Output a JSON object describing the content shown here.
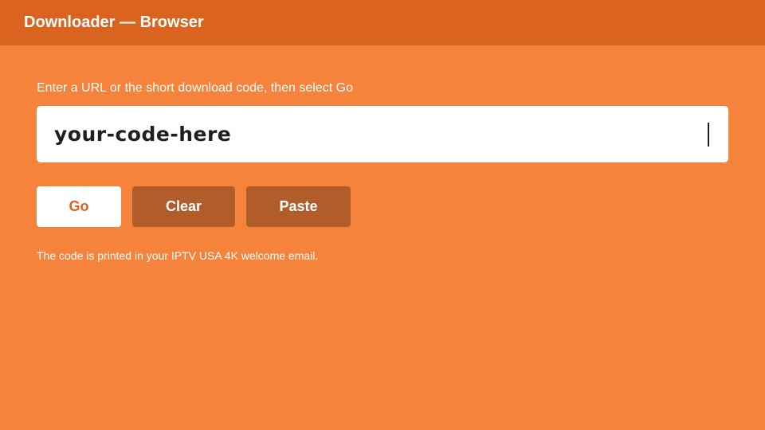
{
  "header": {
    "title": "Downloader — Browser"
  },
  "main": {
    "prompt": "Enter a URL or the short download code, then select Go",
    "url_input": {
      "value": "your-code-here"
    },
    "buttons": {
      "go": "Go",
      "clear": "Clear",
      "paste": "Paste"
    },
    "hint": "The code is printed in your IPTV USA 4K welcome email."
  },
  "colors": {
    "background": "#f5833c",
    "header": "#db6320",
    "secondary_button": "#b05c2b",
    "primary_button_text": "#d8641f"
  }
}
